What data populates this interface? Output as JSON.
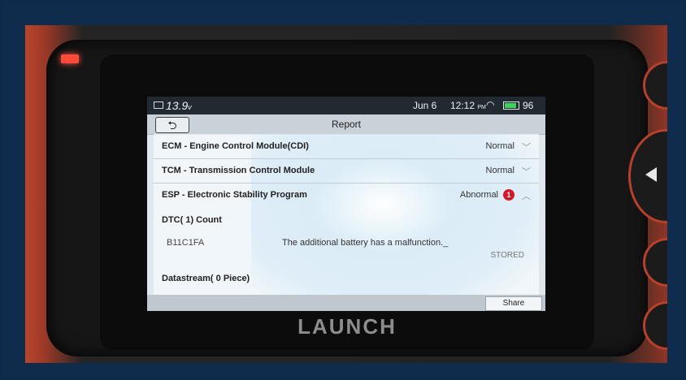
{
  "status_bar": {
    "voltage": "13.9",
    "voltage_unit": "v",
    "date": "Jun 6",
    "time": "12:12",
    "time_suffix": "PM",
    "battery_pct": "96"
  },
  "header": {
    "back_glyph": "⮌",
    "title": "Report"
  },
  "modules": [
    {
      "name": "ECM - Engine Control Module(CDI)",
      "status": "Normal",
      "chevron": "﹀"
    },
    {
      "name": "TCM - Transmission Control Module",
      "status": "Normal",
      "chevron": "﹀"
    },
    {
      "name": "ESP - Electronic Stability Program",
      "status": "Abnormal",
      "badge": "1",
      "chevron": "︿"
    }
  ],
  "dtc": {
    "heading": "DTC( 1) Count",
    "code": "B11C1FA",
    "description": "The additional battery has a malfunction._",
    "state": "STORED"
  },
  "datastream": {
    "heading": "Datastream( 0 Piece)"
  },
  "footer": {
    "share_label": "Share"
  },
  "device": {
    "brand": "LAUNCH"
  },
  "colors": {
    "accent_red": "#d1192c",
    "battery_green": "#3ed25c",
    "case_red": "#b8462f"
  }
}
